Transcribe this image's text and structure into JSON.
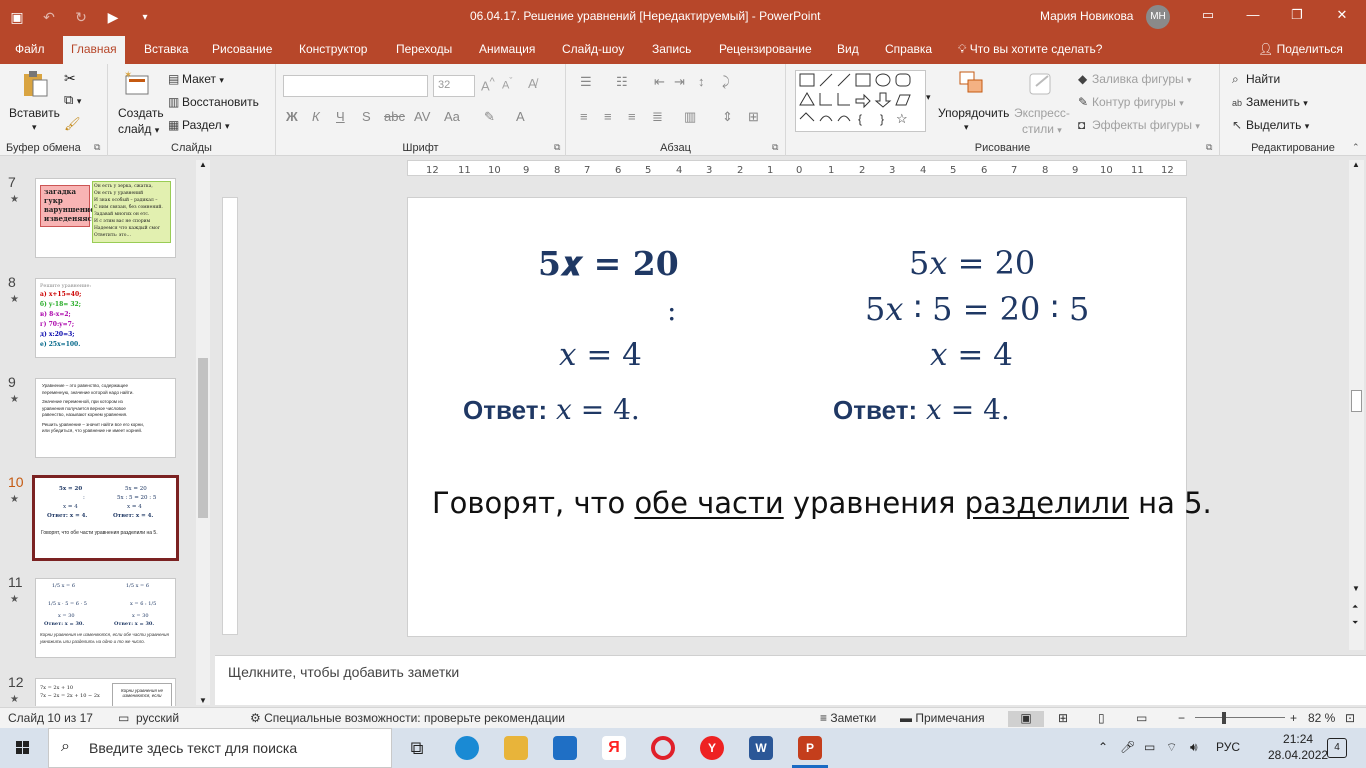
{
  "window": {
    "title": "06.04.17. Решение уравнений [Нередактируемый]  -  PowerPoint",
    "user_name": "Мария Новикова",
    "user_initials": "МН"
  },
  "tabs": [
    "Файл",
    "Главная",
    "Вставка",
    "Рисование",
    "Конструктор",
    "Переходы",
    "Анимация",
    "Слайд-шоу",
    "Запись",
    "Рецензирование",
    "Вид",
    "Справка"
  ],
  "tell_me": "Что вы хотите сделать?",
  "share": "Поделиться",
  "ribbon": {
    "clipboard": {
      "paste": "Вставить",
      "label": "Буфер обмена"
    },
    "slides": {
      "new_slide_1": "Создать",
      "new_slide_2": "слайд",
      "layout": "Макет",
      "reset": "Восстановить",
      "section": "Раздел",
      "label": "Слайды"
    },
    "font": {
      "size": "32",
      "label": "Шрифт"
    },
    "paragraph": {
      "label": "Абзац"
    },
    "drawing": {
      "arrange": "Упорядочить",
      "express_1": "Экспресс-",
      "express_2": "стили",
      "fill": "Заливка фигуры",
      "outline": "Контур фигуры",
      "effects": "Эффекты фигуры",
      "label": "Рисование"
    },
    "editing": {
      "find": "Найти",
      "replace": "Заменить",
      "select": "Выделить",
      "label": "Редактирование"
    }
  },
  "thumbnails": [
    {
      "num": "7",
      "lines": [
        "загадка",
        "гукр",
        "варуншение",
        "изведеняясь"
      ],
      "text": [
        "Он есть у зерка, сжатка,",
        "Он есть у уравнений",
        "И знак особый – радикал –",
        "С ним связан, без сомнений.",
        "Задавай многих он етс.",
        "И с этим вас не спорим",
        "Надеемся что каждый смог",
        "Ответить: это…"
      ]
    },
    {
      "num": "8",
      "header": "Решите уравнение:",
      "items": [
        "а)  x+15=40;",
        "б)  y-18= 32;",
        "в)  8-x=2;",
        "г)  70:y=7;",
        "д)  x:20=3;",
        "е)  25x=100."
      ]
    },
    {
      "num": "9",
      "text": [
        "Уравнение – это равенство, содержащее",
        "переменную, значение которой надо найти.",
        "Значение переменной, при котором из",
        "уравнения получается верное числовое",
        "равенство, называют корнем уравнения.",
        "Решить уравнение – значит найти все его корни,",
        "или убедиться, что уравнение не имеет корней."
      ]
    },
    {
      "num": "10",
      "left": [
        "5x = 20",
        ":",
        "x = 4",
        "Ответ: x = 4."
      ],
      "right": [
        "5x = 20",
        "5x : 5 = 20 : 5",
        "x = 4",
        "Ответ: x = 4."
      ],
      "footer": "Говорят, что обе части уравнения разделили на 5."
    },
    {
      "num": "11",
      "left": [
        "1/5 x = 6",
        "1/5 x · 5 = 6 · 5",
        "x = 30",
        "Ответ: x = 30."
      ],
      "right": [
        "1/5 x = 6",
        "x = 6 : 1/5",
        "x = 30",
        "Ответ: x = 30."
      ],
      "footer": "Корни уравнения не изменяются, если обе части уравнения умножить или разделить на одно и то же число."
    },
    {
      "num": "12",
      "left": [
        "7x = 2x + 10",
        "7x − 2x = 2x + 10 − 2x"
      ],
      "right": "Корни уравнения не изменяются, если"
    }
  ],
  "slide": {
    "left_eq1": "5𝒙 = 20",
    "left_colon": ":",
    "left_eq3": "𝑥 = 4",
    "right_eq1": "5𝑥 = 20",
    "right_eq2": "5𝑥 ∶ 5 = 20 ∶ 5",
    "right_eq3": "𝑥 = 4",
    "answer_label": "Ответ:",
    "answer_value": " 𝑥 =  4.",
    "sentence_1": "Говорят, что ",
    "sentence_u1": "обе части",
    "sentence_2": " уравнения ",
    "sentence_u2": "разделили",
    "sentence_3": " на 5."
  },
  "notes_placeholder": "Щелкните, чтобы добавить заметки",
  "status": {
    "slide_counter": "Слайд 10 из 17",
    "language": "русский",
    "accessibility": "Специальные возможности: проверьте рекомендации",
    "notes": "Заметки",
    "comments": "Примечания",
    "zoom": "82 %"
  },
  "taskbar": {
    "search_placeholder": "Введите здесь текст для поиска",
    "lang": "РУС",
    "time": "21:24",
    "date": "28.04.2022",
    "notifications": "4"
  },
  "colors": {
    "accent": "#b7472a",
    "equation": "#1f3864",
    "selected_thumb": "#7b2222"
  }
}
